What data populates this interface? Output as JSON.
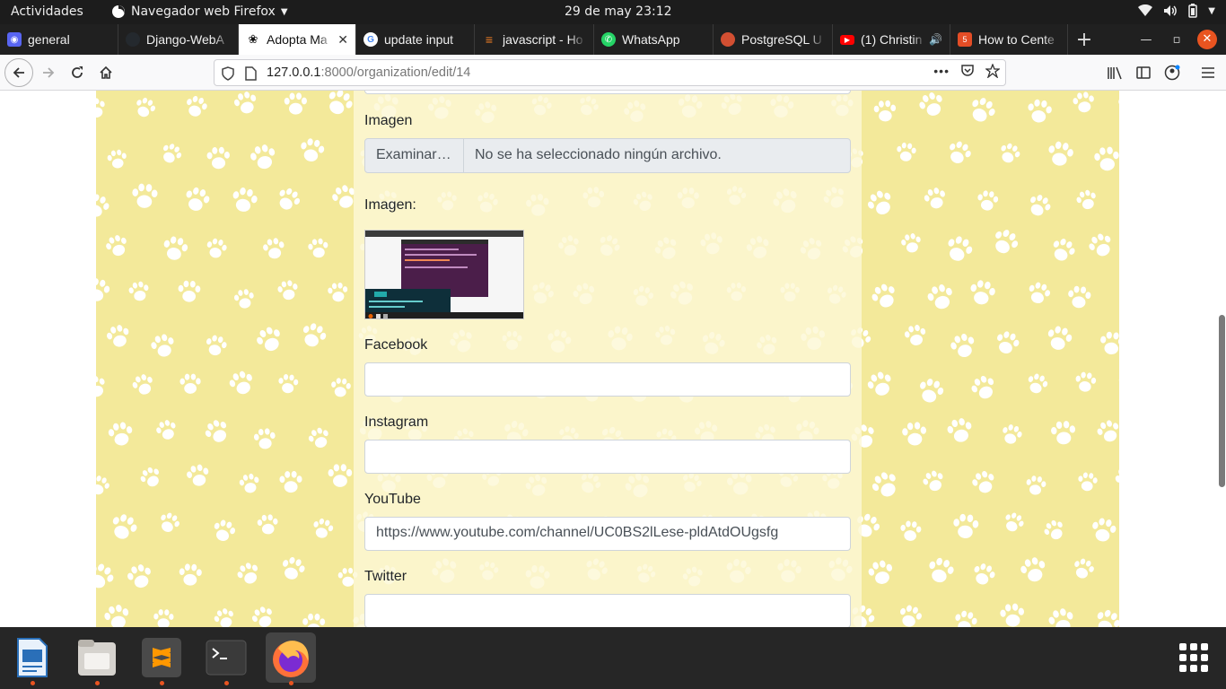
{
  "topbar": {
    "activities": "Actividades",
    "app_menu": "Navegador web Firefox",
    "clock": "29 de may  23:12"
  },
  "tabs": [
    {
      "title": "general",
      "icon": "discord-icon",
      "color": "#5865f2"
    },
    {
      "title": "Django-WebA",
      "icon": "github-icon",
      "color": "#24292e"
    },
    {
      "title": "Adopta Ma",
      "icon": "paw-icon",
      "color": "#111111",
      "active": true
    },
    {
      "title": "update input",
      "icon": "google-icon",
      "color": "#4285f4"
    },
    {
      "title": "javascript - Ho",
      "icon": "stackoverflow-icon",
      "color": "#f48024"
    },
    {
      "title": "WhatsApp",
      "icon": "whatsapp-icon",
      "color": "#25d366"
    },
    {
      "title": "PostgreSQL U",
      "icon": "postgresql-icon",
      "color": "#d24f32"
    },
    {
      "title": "(1) Christin",
      "icon": "youtube-icon",
      "color": "#ff0000"
    },
    {
      "title": "How to Cente",
      "icon": "w3schools-icon",
      "color": "#e44d26"
    }
  ],
  "navbar": {
    "url_host": "127.0.0.1",
    "url_rest": ":8000/organization/edit/14"
  },
  "form": {
    "image_label": "Imagen",
    "browse_label": "Examinar…",
    "no_file_text": "No se ha seleccionado ningún archivo.",
    "current_image_label": "Imagen:",
    "facebook_label": "Facebook",
    "facebook_value": "",
    "instagram_label": "Instagram",
    "instagram_value": "",
    "youtube_label": "YouTube",
    "youtube_value": "https://www.youtube.com/channel/UC0BS2lLese-pldAtdOUgsfg",
    "twitter_label": "Twitter",
    "twitter_value": ""
  },
  "dock": [
    {
      "name": "libreoffice-writer-icon",
      "running": true
    },
    {
      "name": "files-icon",
      "running": true
    },
    {
      "name": "sublime-text-icon",
      "running": true
    },
    {
      "name": "terminal-icon",
      "running": true
    },
    {
      "name": "firefox-icon",
      "running": true
    }
  ],
  "colors": {
    "page_bg": "#f3e99a",
    "paw": "#ffffff",
    "accent": "#e95420"
  }
}
